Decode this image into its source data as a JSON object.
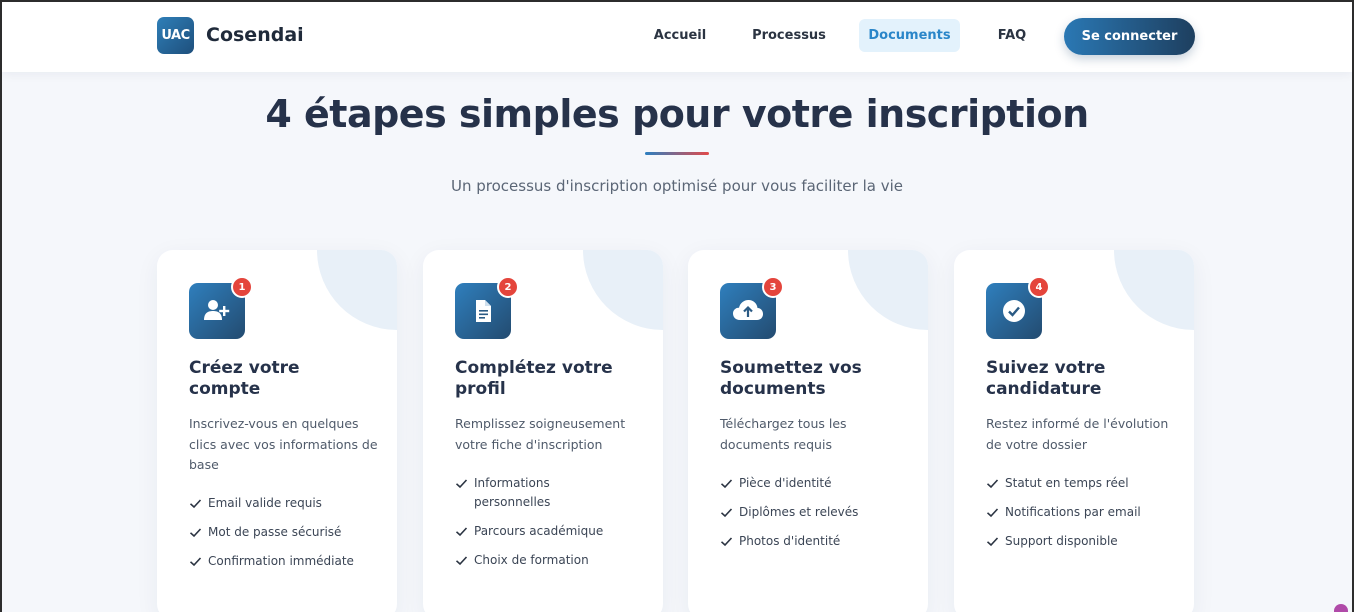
{
  "header": {
    "logo_text": "UAC",
    "brand": "Cosendai",
    "nav": [
      "Accueil",
      "Processus",
      "Documents",
      "FAQ"
    ],
    "active_nav": "Documents",
    "login_label": "Se connecter"
  },
  "hero": {
    "title": "4 étapes simples pour votre inscription",
    "subtitle": "Un processus d'inscription optimisé pour vous faciliter la vie"
  },
  "steps": [
    {
      "number": "1",
      "icon": "user-plus-icon",
      "title_line1": "Créez votre",
      "title_line2": "compte",
      "desc": "Inscrivez-vous en quelques clics avec vos informations de base",
      "items": [
        "Email valide requis",
        "Mot de passe sécurisé",
        "Confirmation immédiate"
      ]
    },
    {
      "number": "2",
      "icon": "document-icon",
      "title_line1": "Complétez votre",
      "title_line2": "profil",
      "desc": "Remplissez soigneusement votre fiche d'inscription",
      "items": [
        "Informations personnelles",
        "Parcours académique",
        "Choix de formation"
      ]
    },
    {
      "number": "3",
      "icon": "cloud-upload-icon",
      "title_line1": "Soumettez vos",
      "title_line2": "documents",
      "desc": "Téléchargez tous les documents requis",
      "items": [
        "Pièce d'identité",
        "Diplômes et relevés",
        "Photos d'identité"
      ]
    },
    {
      "number": "4",
      "icon": "check-circle-icon",
      "title_line1": "Suivez votre",
      "title_line2": "candidature",
      "desc": "Restez informé de l'évolution de votre dossier",
      "items": [
        "Statut en temps réel",
        "Notifications par email",
        "Support disponible"
      ]
    }
  ],
  "colors": {
    "primary": "#2a86c9",
    "dark": "#1e3f5f",
    "badge": "#e4453c"
  }
}
